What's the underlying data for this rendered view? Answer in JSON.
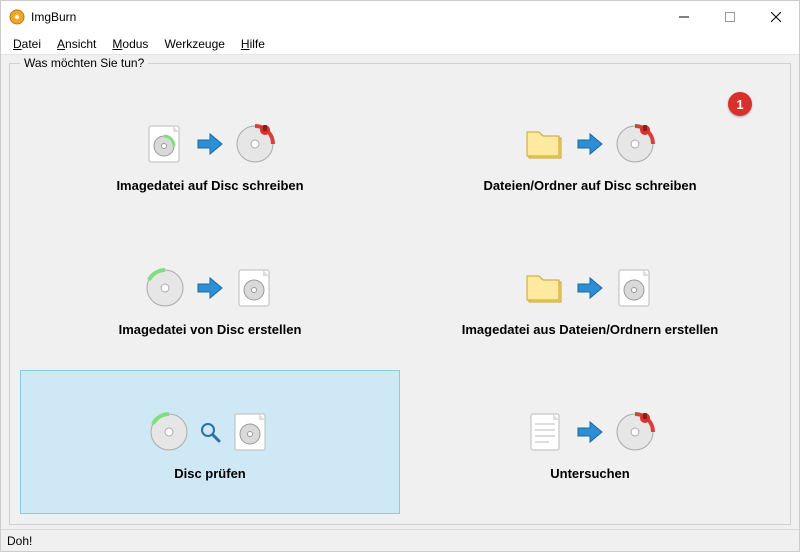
{
  "window": {
    "title": "ImgBurn"
  },
  "menu": {
    "datei": "Datei",
    "ansicht": "Ansicht",
    "modus": "Modus",
    "werkzeuge": "Werkzeuge",
    "hilfe": "Hilfe"
  },
  "group": {
    "label": "Was möchten Sie tun?"
  },
  "actions": {
    "write_image": "Imagedatei auf Disc schreiben",
    "write_files": "Dateien/Ordner auf Disc schreiben",
    "create_image_from_disc": "Imagedatei von Disc erstellen",
    "create_image_from_files": "Imagedatei aus Dateien/Ordnern erstellen",
    "verify_disc": "Disc prüfen",
    "discovery": "Untersuchen"
  },
  "badge": {
    "write_files": "1"
  },
  "status": {
    "text": "Doh!"
  }
}
